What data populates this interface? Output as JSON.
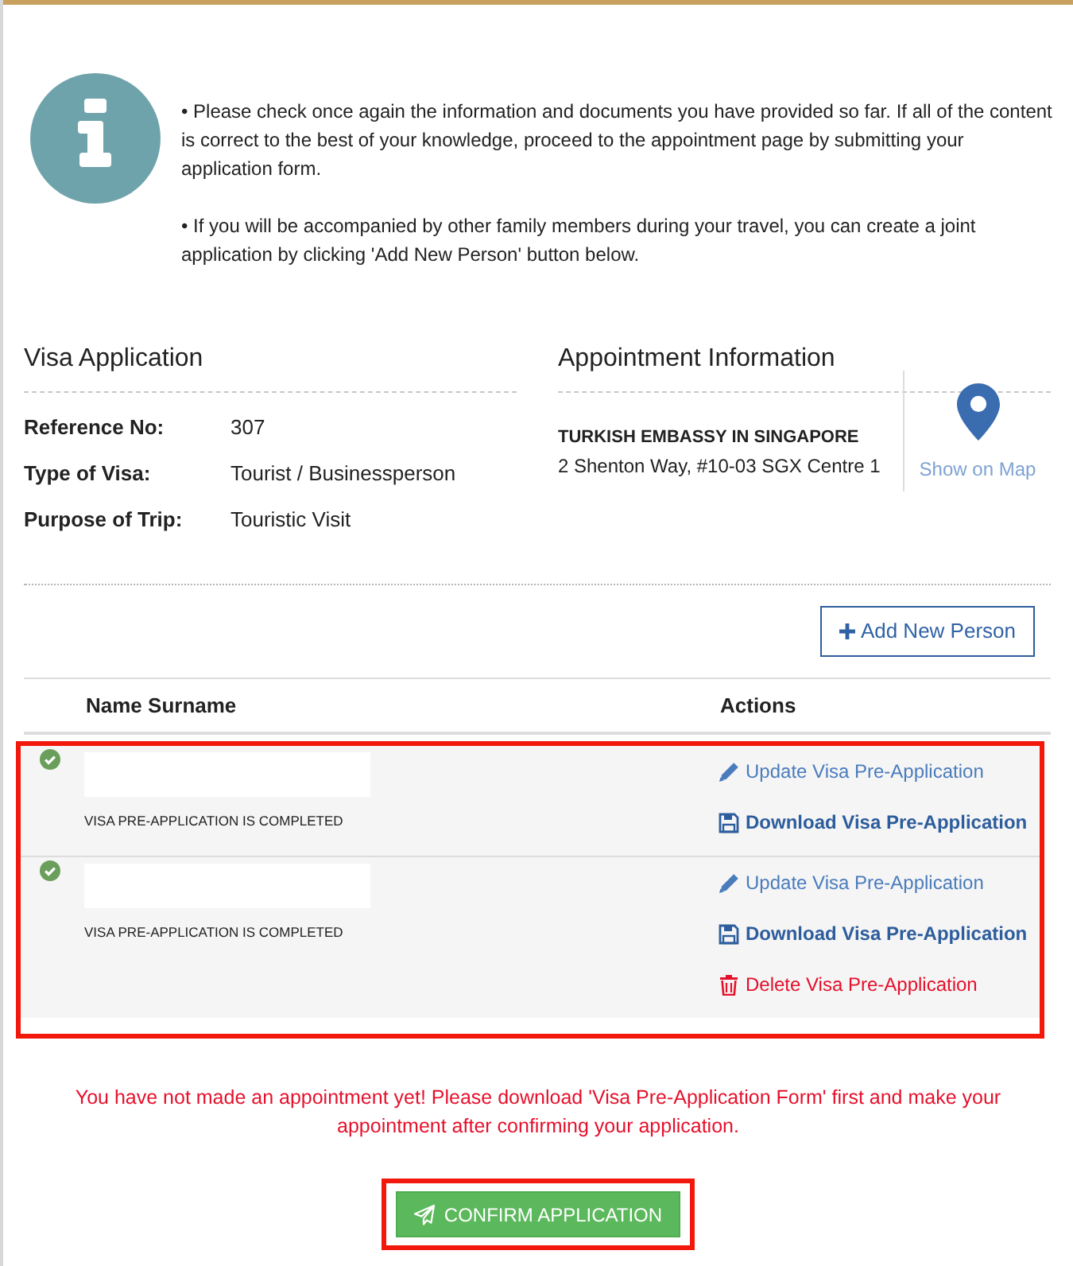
{
  "notice": {
    "paragraphs": [
      "• Please check once again the information and documents you have provided so far. If all of the content is correct to the best of your knowledge, proceed to the appointment page by submitting your application form.",
      "• If you will be accompanied by other family members during your travel, you can create a joint application by clicking 'Add New Person' button below."
    ]
  },
  "visa_application": {
    "title": "Visa Application",
    "fields": [
      {
        "label": "Reference No:",
        "value": "307"
      },
      {
        "label": "Type of Visa:",
        "value": "Tourist / Businessperson"
      },
      {
        "label": "Purpose of Trip:",
        "value": "Touristic Visit"
      }
    ]
  },
  "appointment_information": {
    "title": "Appointment Information",
    "embassy": "TURKISH EMBASSY IN SINGAPORE",
    "address": "2 Shenton Way, #10-03 SGX Centre 1",
    "map_link": "Show on Map"
  },
  "add_person_button": {
    "label": "Add New Person"
  },
  "applicants_table": {
    "columns": [
      "Name Surname",
      "Actions"
    ],
    "highlighted": true,
    "rows": [
      {
        "completed": true,
        "status": "VISA PRE-APPLICATION IS COMPLETED",
        "actions": [
          {
            "kind": "update",
            "label": "Update Visa Pre-Application"
          },
          {
            "kind": "download",
            "label": "Download Visa Pre-Application"
          }
        ]
      },
      {
        "completed": true,
        "status": "VISA PRE-APPLICATION IS COMPLETED",
        "actions": [
          {
            "kind": "update",
            "label": "Update Visa Pre-Application"
          },
          {
            "kind": "download",
            "label": "Download Visa Pre-Application"
          },
          {
            "kind": "delete",
            "label": "Delete Visa Pre-Application"
          }
        ]
      }
    ]
  },
  "warning": "You have not made an appointment yet! Please download 'Visa Pre-Application Form' first and make your appointment after confirming your application.",
  "confirm_button": {
    "label": "CONFIRM APPLICATION",
    "highlighted": true
  }
}
